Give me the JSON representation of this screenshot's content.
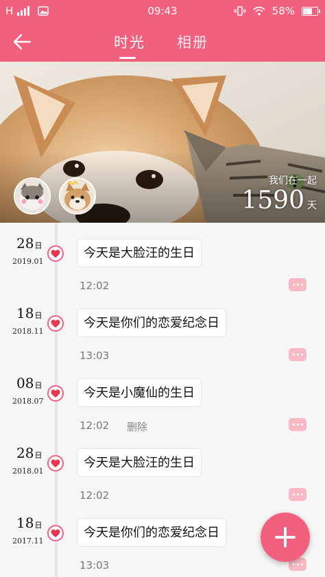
{
  "status_bar": {
    "network": "H",
    "time": "09:43",
    "battery": "58%"
  },
  "app_bar": {
    "tabs": [
      {
        "label": "时光",
        "active": true
      },
      {
        "label": "相册",
        "active": false
      }
    ]
  },
  "banner": {
    "together_label": "我们在一起",
    "days": "1590",
    "days_unit": "天"
  },
  "timeline": {
    "day_suffix": "日",
    "entries": [
      {
        "day": "28",
        "year_month": "2019.01",
        "text": "今天是大脸汪的生日",
        "time": "12:02",
        "delete": ""
      },
      {
        "day": "18",
        "year_month": "2018.11",
        "text": "今天是你们的恋爱纪念日",
        "time": "13:03",
        "delete": ""
      },
      {
        "day": "08",
        "year_month": "2018.07",
        "text": "今天是小魔仙的生日",
        "time": "12:02",
        "delete": "删除"
      },
      {
        "day": "28",
        "year_month": "2018.01",
        "text": "今天是大脸汪的生日",
        "time": "12:02",
        "delete": ""
      },
      {
        "day": "18",
        "year_month": "2017.11",
        "text": "今天是你们的恋爱纪念日",
        "time": "13:03",
        "delete": ""
      }
    ]
  },
  "colors": {
    "accent": "#f2607e",
    "comment_button": "#f7b9c4"
  }
}
